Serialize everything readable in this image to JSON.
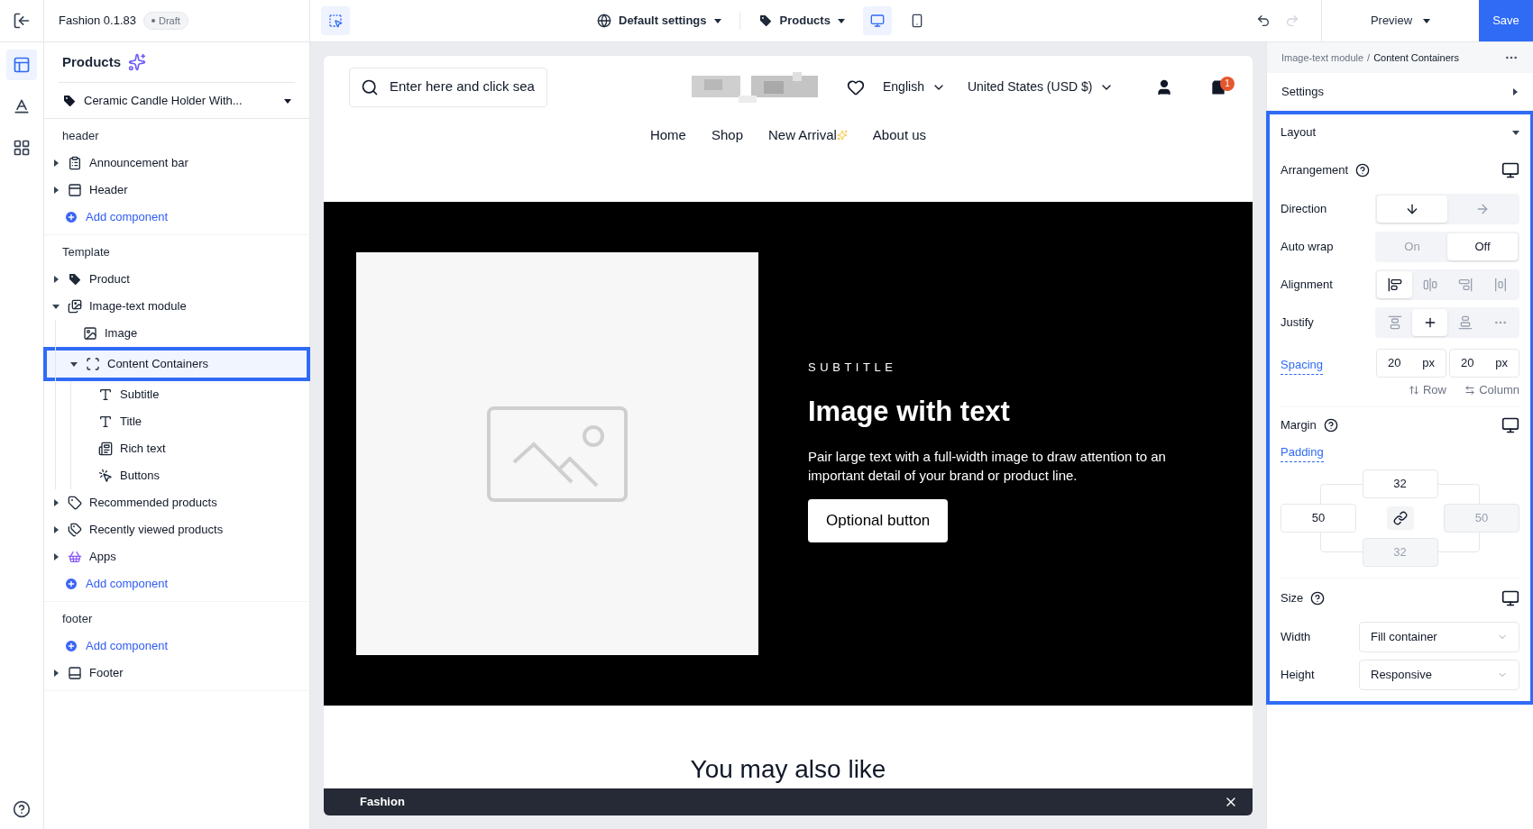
{
  "rail": {
    "items": [
      {
        "kind": "layout",
        "selected": true
      },
      {
        "kind": "style",
        "selected": false
      },
      {
        "kind": "apps",
        "selected": false
      }
    ]
  },
  "project": {
    "name": "Fashion 0.1.83",
    "badge": "Draft"
  },
  "toolbar": {
    "select_tool": {
      "selected": true
    },
    "theme_menu": "Default settings",
    "page_menu": "Products",
    "devices": [
      {
        "kind": "desktop",
        "selected": true
      },
      {
        "kind": "mobile",
        "selected": false
      }
    ],
    "undo": {
      "disabled": false
    },
    "redo": {
      "disabled": true
    },
    "preview": "Preview",
    "save": "Save"
  },
  "tree": {
    "title": "Products",
    "page_select": "Ceramic Candle Holder With...",
    "sections": [
      {
        "label": "header",
        "items": [
          {
            "kind": "announcement",
            "label": "Announcement bar",
            "expanded": false,
            "selected": false
          },
          {
            "kind": "header",
            "label": "Header",
            "expanded": false,
            "selected": false
          },
          {
            "kind": "add",
            "label": "Add component"
          }
        ]
      },
      {
        "label": "Template",
        "items": [
          {
            "kind": "product",
            "label": "Product",
            "expanded": false,
            "selected": false
          },
          {
            "kind": "imagetext",
            "label": "Image-text module",
            "expanded": true,
            "selected": false,
            "children": [
              {
                "kind": "image",
                "label": "Image",
                "selected": false
              },
              {
                "kind": "container",
                "label": "Content Containers",
                "expanded": true,
                "selected": true,
                "children": [
                  {
                    "kind": "text",
                    "label": "Subtitle",
                    "selected": false
                  },
                  {
                    "kind": "text",
                    "label": "Title",
                    "selected": false
                  },
                  {
                    "kind": "richtext",
                    "label": "Rich text",
                    "selected": false
                  },
                  {
                    "kind": "buttons",
                    "label": "Buttons",
                    "selected": false
                  }
                ]
              }
            ]
          },
          {
            "kind": "recommended",
            "label": "Recommended products",
            "expanded": false,
            "selected": false
          },
          {
            "kind": "recent",
            "label": "Recently viewed products",
            "expanded": false,
            "selected": false
          },
          {
            "kind": "apps",
            "label": "Apps",
            "expanded": false,
            "selected": false
          },
          {
            "kind": "add",
            "label": "Add component"
          }
        ]
      },
      {
        "label": "footer",
        "items": [
          {
            "kind": "add",
            "label": "Add component"
          },
          {
            "kind": "footer",
            "label": "Footer",
            "expanded": false,
            "selected": false
          }
        ]
      }
    ]
  },
  "store": {
    "search": {
      "value": "Enter here and click sea"
    },
    "language": "English",
    "currency": "United States (USD $)",
    "cart_count": "1",
    "nav": [
      {
        "label": "Home"
      },
      {
        "label": "Shop"
      },
      {
        "label": "New Arrival",
        "sparkle": true
      },
      {
        "label": "About us"
      }
    ],
    "hero": {
      "subtitle": "SUBTITLE",
      "title": "Image with text",
      "text": "Pair large text with a full-width image to draw attention to an important detail of your brand or product line.",
      "button": "Optional button"
    },
    "next_heading": "You may also like",
    "bottom_bar": {
      "title": "Fashion"
    }
  },
  "inspector": {
    "breadcrumb": [
      "Image-text module",
      "Content Containers"
    ],
    "breadcrumb_separator": "/",
    "settings": {
      "label": "Settings",
      "expanded": false
    },
    "layout": {
      "label": "Layout",
      "expanded": true,
      "arrangement": "Arrangement",
      "direction": {
        "label": "Direction",
        "options": [
          {
            "kind": "down",
            "selected": true
          },
          {
            "kind": "right",
            "selected": false
          }
        ]
      },
      "auto_wrap": {
        "label": "Auto wrap",
        "options": [
          {
            "label": "On",
            "selected": false
          },
          {
            "label": "Off",
            "selected": true
          }
        ]
      },
      "alignment": {
        "label": "Alignment",
        "options": [
          {
            "kind": "start",
            "selected": true
          },
          {
            "kind": "center",
            "selected": false
          },
          {
            "kind": "end",
            "selected": false
          },
          {
            "kind": "stretch",
            "selected": false
          }
        ]
      },
      "justify": {
        "label": "Justify",
        "options": [
          {
            "kind": "start",
            "selected": false
          },
          {
            "kind": "center",
            "selected": true
          },
          {
            "kind": "end",
            "selected": false
          },
          {
            "kind": "more",
            "selected": false
          }
        ]
      },
      "spacing": {
        "label": "Spacing",
        "fields": [
          {
            "value": "20",
            "unit": "px",
            "caption": "Row"
          },
          {
            "value": "20",
            "unit": "px",
            "caption": "Column"
          }
        ]
      },
      "margin": "Margin",
      "padding": {
        "label": "Padding",
        "top": {
          "value": "32",
          "disabled": false
        },
        "left": {
          "value": "50",
          "disabled": false
        },
        "right": {
          "value": "50",
          "disabled": true
        },
        "bottom": {
          "value": "32",
          "disabled": true
        }
      },
      "size": {
        "label": "Size",
        "width": {
          "label": "Width",
          "value": "Fill container"
        },
        "height": {
          "label": "Height",
          "value": "Responsive"
        }
      }
    }
  }
}
